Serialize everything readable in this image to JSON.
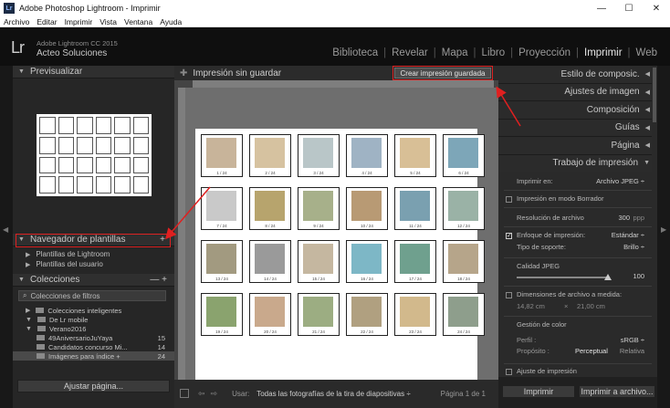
{
  "window": {
    "title": "Adobe Photoshop Lightroom - Imprimir",
    "app_icon": "Lr",
    "minimize": "—",
    "maximize": "☐",
    "close": "✕"
  },
  "menu": [
    "Archivo",
    "Editar",
    "Imprimir",
    "Vista",
    "Ventana",
    "Ayuda"
  ],
  "identity": {
    "logo": "Lr",
    "version": "Adobe Lightroom CC 2015",
    "name": "Acteo Soluciones"
  },
  "modules": [
    "Biblioteca",
    "Revelar",
    "Mapa",
    "Libro",
    "Proyección",
    "Imprimir",
    "Web"
  ],
  "active_module": "Imprimir",
  "left": {
    "preview_title": "Previsualizar",
    "templates_title": "Navegador de plantillas",
    "templates_plus": "+",
    "template_items": [
      "Plantillas de Lightroom",
      "Plantillas del usuario"
    ],
    "collections_title": "Colecciones",
    "collections_actions": "— +",
    "filter_placeholder": "Colecciones de filtros",
    "collections": [
      {
        "label": "Colecciones inteligentes",
        "count": ""
      },
      {
        "label": "De Lr mobile",
        "count": ""
      },
      {
        "label": "Verano2016",
        "count": ""
      },
      {
        "label": "49AniversarioJuYaya",
        "count": "15"
      },
      {
        "label": "Candidatos concurso Mi...",
        "count": "14"
      },
      {
        "label": "Imágenes para índice +",
        "count": "24"
      }
    ],
    "page_setup_button": "Ajustar página..."
  },
  "center": {
    "job_title": "Impresión sin guardar",
    "save_print_button": "Crear impresión guardada",
    "use_label": "Usar:",
    "use_value": "Todas las fotografías de la tira de diapositivas ÷",
    "page_counter": "Página 1 de 1",
    "cell_labels": [
      "1 / 24",
      "2 / 24",
      "3 / 24",
      "4 / 24",
      "5 / 24",
      "6 / 24",
      "7 / 24",
      "8 / 24",
      "9 / 24",
      "10 / 24",
      "11 / 24",
      "12 / 24",
      "13 / 24",
      "14 / 24",
      "15 / 24",
      "16 / 24",
      "17 / 24",
      "18 / 24",
      "19 / 24",
      "20 / 24",
      "21 / 24",
      "22 / 24",
      "23 / 24",
      "24 / 24"
    ],
    "photo_colors": [
      "#c8b49a",
      "#d6c2a0",
      "#b9c6c8",
      "#9fb3c4",
      "#d8bf96",
      "#7da6b8",
      "#c9c9c9",
      "#b7a46d",
      "#a7b08a",
      "#b89a74",
      "#7aa0b0",
      "#9ab2a6",
      "#a29a80",
      "#9a9a9a",
      "#c5b7a0",
      "#7db7c6",
      "#6fa08e",
      "#b6a58a",
      "#8aa36e",
      "#c9a98c",
      "#9cad82",
      "#b0a080",
      "#d2b98c",
      "#8e9e8c"
    ]
  },
  "right": {
    "sections": [
      "Estilo de composic.",
      "Ajustes de imagen",
      "Composición",
      "Guías",
      "Página",
      "Trabajo de impresión"
    ],
    "print_to_label": "Imprimir en:",
    "print_to_value": "Archivo JPEG ÷",
    "draft_mode": "Impresión en modo Borrador",
    "file_resolution_label": "Resolución de archivo",
    "file_resolution_value": "300",
    "file_resolution_unit": "ppp",
    "sharpening_label": "Enfoque de impresión:",
    "sharpening_value": "Estándar ÷",
    "media_label": "Tipo de soporte:",
    "media_value": "Brillo ÷",
    "jpeg_quality_label": "Calidad JPEG",
    "jpeg_quality_value": "100",
    "custom_dims_label": "Dimensiones de archivo a medida:",
    "custom_dims_w": "14,82 cm",
    "custom_dims_x": "×",
    "custom_dims_h": "21,00 cm",
    "color_mgmt_label": "Gestión de color",
    "profile_label": "Perfil :",
    "profile_value": "sRGB ÷",
    "intent_label": "Propósito :",
    "intent_perceptual": "Perceptual",
    "intent_relative": "Relativa",
    "print_adjust_label": "Ajuste de impresión",
    "print_button": "Imprimir",
    "print_to_file_button": "Imprimir a archivo..."
  }
}
